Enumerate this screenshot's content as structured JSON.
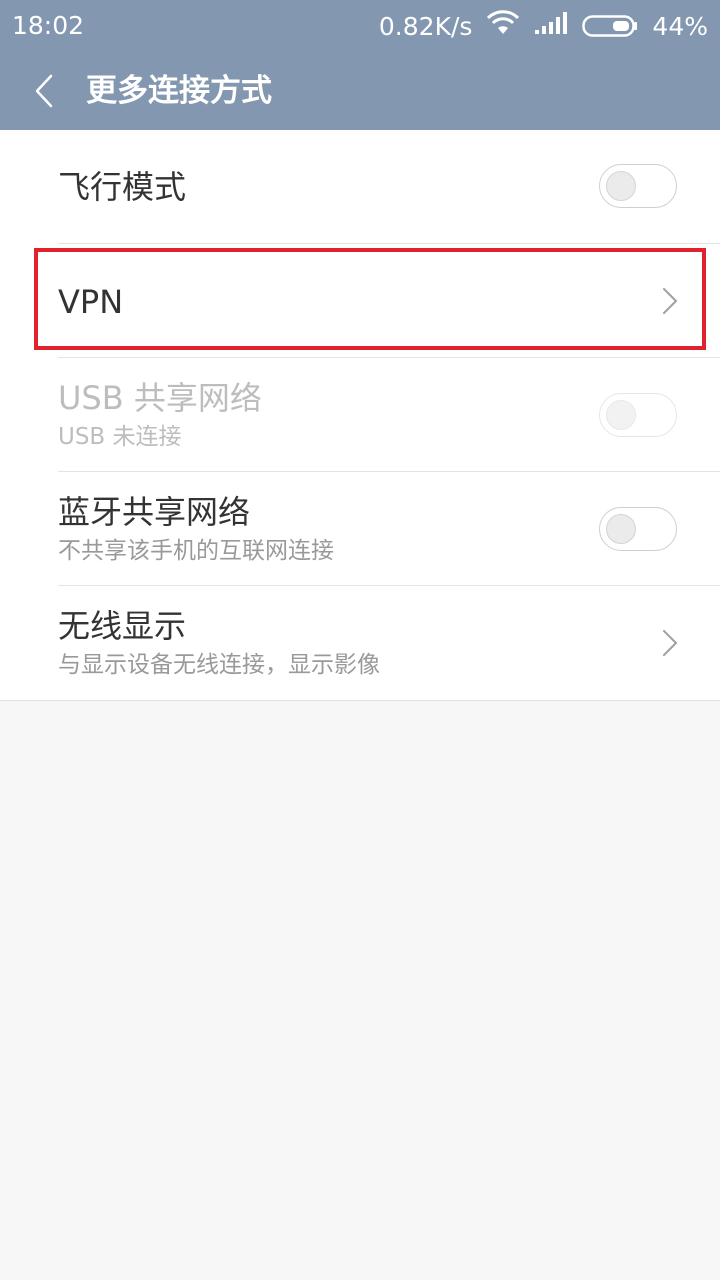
{
  "status_bar": {
    "time": "18:02",
    "network_speed": "0.82K/s",
    "battery_percent": "44%",
    "wifi_icon": "wifi-icon",
    "signal_icon": "signal-icon",
    "battery_icon": "battery-icon"
  },
  "header": {
    "back_icon": "chevron-left-icon",
    "title": "更多连接方式"
  },
  "items": [
    {
      "title": "飞行模式",
      "control": "toggle",
      "checked": false,
      "enabled": true
    },
    {
      "title": "VPN",
      "control": "chevron",
      "enabled": true
    },
    {
      "title": "USB 共享网络",
      "subtitle": "USB 未连接",
      "control": "toggle",
      "checked": false,
      "enabled": false
    },
    {
      "title": "蓝牙共享网络",
      "subtitle": "不共享该手机的互联网连接",
      "control": "toggle",
      "checked": false,
      "enabled": true
    },
    {
      "title": "无线显示",
      "subtitle": "与显示设备无线连接，显示影像",
      "control": "chevron",
      "enabled": true
    }
  ],
  "colors": {
    "header_bg": "#8497b0",
    "highlight": "#e0222e",
    "page_bg": "#f7f7f7"
  }
}
